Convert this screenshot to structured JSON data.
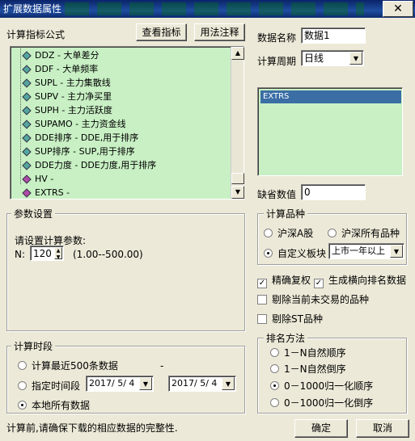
{
  "window": {
    "title": "扩展数据属性",
    "close_glyph": "✕"
  },
  "formula": {
    "label": "计算指标公式",
    "view_button": "查看指标",
    "usage_button": "用法注释",
    "items": [
      {
        "text": "DDZ - 大单差分",
        "icon": "green"
      },
      {
        "text": "DDF - 大单频率",
        "icon": "green"
      },
      {
        "text": "SUPL - 主力集散线",
        "icon": "green"
      },
      {
        "text": "SUPV - 主力净买里",
        "icon": "green"
      },
      {
        "text": "SUPH - 主力活跃度",
        "icon": "green"
      },
      {
        "text": "SUPAMO - 主力资金线",
        "icon": "green"
      },
      {
        "text": "DDE排序 - DDE,用于排序",
        "icon": "green"
      },
      {
        "text": "SUP排序 - SUP,用于排序",
        "icon": "green"
      },
      {
        "text": "DDE力度 - DDE力度,用于排序",
        "icon": "green"
      },
      {
        "text": "HV -",
        "icon": "purple"
      },
      {
        "text": "EXTRS -",
        "icon": "purple"
      }
    ]
  },
  "data_name": {
    "label": "数据名称",
    "value": "数据1"
  },
  "period": {
    "label": "计算周期",
    "value": "日线"
  },
  "extrs_list": {
    "selected": "EXTRS"
  },
  "default_value": {
    "label": "缺省数值",
    "value": "0"
  },
  "params": {
    "group": "参数设置",
    "prompt": "请设置计算参数:",
    "n_label": "N:",
    "n_value": "120",
    "range": "(1.00--500.00)"
  },
  "variety": {
    "group": "计算品种",
    "opt_a": "沪深A股",
    "opt_all": "沪深所有品种",
    "opt_custom": "自定义板块",
    "custom_value": "上市一年以上",
    "selected": "custom"
  },
  "checks": {
    "precise": {
      "label": "精确复权",
      "checked": true
    },
    "horizontal": {
      "label": "生成横向排名数据",
      "checked": true
    },
    "exclude_untraded": {
      "label": "剔除当前未交易的品种",
      "checked": false
    },
    "exclude_st": {
      "label": "剔除ST品种",
      "checked": false
    }
  },
  "rank": {
    "group": "排名方法",
    "options": [
      "1－N自然顺序",
      "1－N自然倒序",
      "0－1000归一化顺序",
      "0－1000归一化倒序"
    ],
    "selected": 2
  },
  "time": {
    "group": "计算时段",
    "opt_recent": "计算最近500条数据",
    "opt_range": "指定时间段",
    "date_from": "2017/ 5/ 4",
    "date_to": "2017/ 5/ 4",
    "dash": "-",
    "opt_local": "本地所有数据",
    "selected": "local"
  },
  "footer": {
    "status": "计算前,请确保下载的相应数据的完整性.",
    "ok": "确定",
    "cancel": "取消"
  },
  "colors": {
    "list_bg": "#c8f0c4",
    "title_bg": "#0a246a",
    "selection": "#3a6ea5"
  }
}
